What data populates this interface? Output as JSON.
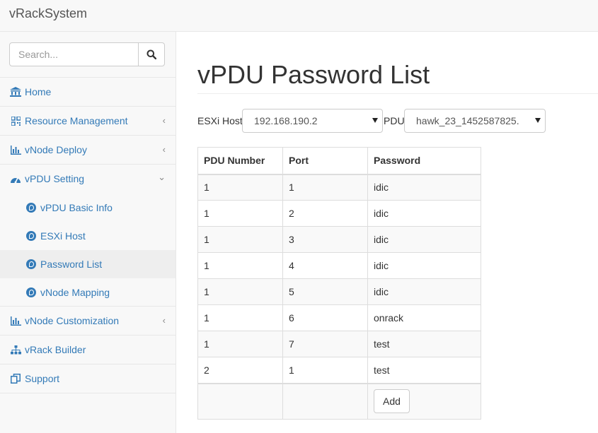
{
  "app": {
    "brand": "vRackSystem"
  },
  "search": {
    "placeholder": "Search..."
  },
  "sidebar": {
    "items": [
      {
        "label": "Home"
      },
      {
        "label": "Resource Management"
      },
      {
        "label": "vNode Deploy"
      },
      {
        "label": "vPDU Setting",
        "children": [
          {
            "label": "vPDU Basic Info"
          },
          {
            "label": "ESXi Host"
          },
          {
            "label": "Password List",
            "active": true
          },
          {
            "label": "vNode Mapping"
          }
        ]
      },
      {
        "label": "vNode Customization"
      },
      {
        "label": "vRack Builder"
      },
      {
        "label": "Support"
      }
    ]
  },
  "main": {
    "title": "vPDU Password List",
    "filters": {
      "esxi_label": "ESXi Host",
      "esxi_value": "192.168.190.2",
      "pdu_label": "PDU",
      "pdu_value": "hawk_23_1452587825."
    },
    "table": {
      "headers": [
        "PDU Number",
        "Port",
        "Password"
      ],
      "rows": [
        [
          "1",
          "1",
          "idic"
        ],
        [
          "1",
          "2",
          "idic"
        ],
        [
          "1",
          "3",
          "idic"
        ],
        [
          "1",
          "4",
          "idic"
        ],
        [
          "1",
          "5",
          "idic"
        ],
        [
          "1",
          "6",
          "onrack"
        ],
        [
          "1",
          "7",
          "test"
        ],
        [
          "2",
          "1",
          "test"
        ]
      ],
      "add_label": "Add"
    }
  },
  "colors": {
    "link": "#337ab7",
    "sidebar_bg": "#f8f8f8",
    "active_bg": "#eeeeee"
  }
}
